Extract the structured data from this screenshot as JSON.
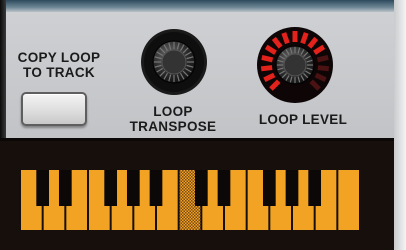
{
  "copy_loop": {
    "label_line1": "COPY LOOP",
    "label_line2": "TO TRACK"
  },
  "loop_transpose": {
    "label_line1": "LOOP",
    "label_line2": "TRANSPOSE"
  },
  "loop_level": {
    "label": "LOOP LEVEL",
    "level_fraction": 0.75
  },
  "keyboard": {
    "white_keys": 15,
    "highlighted_white_key_index": 7
  },
  "colors": {
    "panel": "#c4c6c9",
    "level_led": "#e4221c",
    "key_orange": "#f2a323",
    "display_bg": "#160f0c"
  }
}
